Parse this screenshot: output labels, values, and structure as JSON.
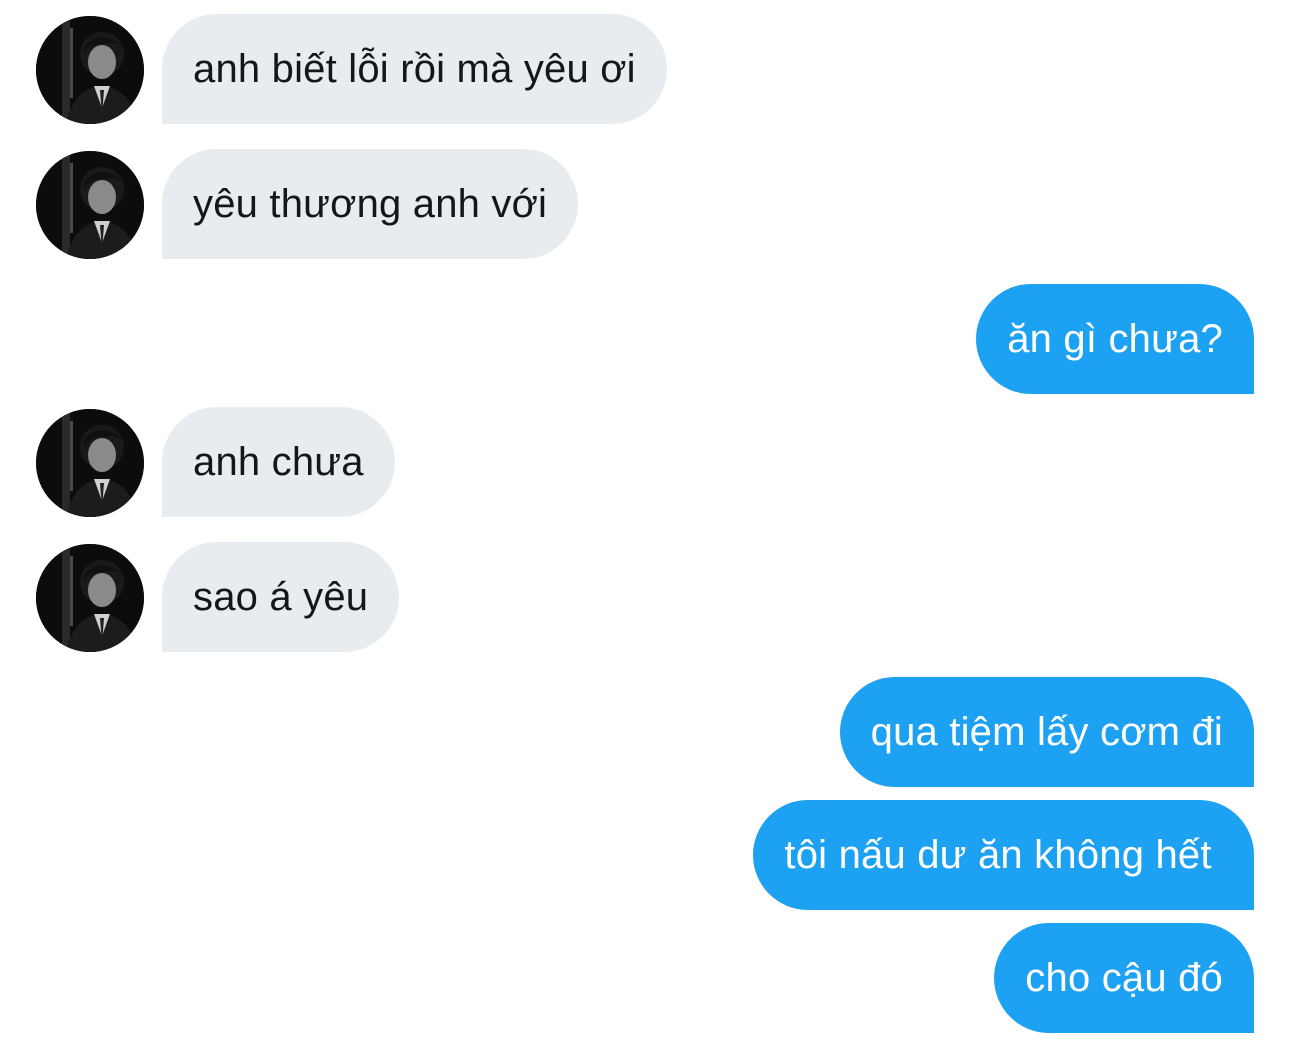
{
  "conversation": {
    "messages": [
      {
        "sender": "other",
        "avatar_icon": "profile-photo-icon",
        "text": "anh biết lỗi rồi mà yêu ơi"
      },
      {
        "sender": "other",
        "avatar_icon": "profile-photo-icon",
        "text": "yêu thương anh với"
      },
      {
        "sender": "me",
        "text": "ăn gì chưa?"
      },
      {
        "sender": "other",
        "avatar_icon": "profile-photo-icon",
        "text": "anh chưa"
      },
      {
        "sender": "other",
        "avatar_icon": "profile-photo-icon",
        "text": "sao á yêu"
      },
      {
        "sender": "me",
        "text": "qua tiệm lấy cơm đi"
      },
      {
        "sender": "me",
        "text": "tôi nấu dư ăn không hết "
      },
      {
        "sender": "me",
        "text": "cho cậu đó"
      }
    ]
  },
  "colors": {
    "incoming_bubble": "#e6ecf0",
    "incoming_text": "#14171a",
    "outgoing_bubble": "#1da1f2",
    "outgoing_text": "#ffffff",
    "background": "#ffffff"
  }
}
